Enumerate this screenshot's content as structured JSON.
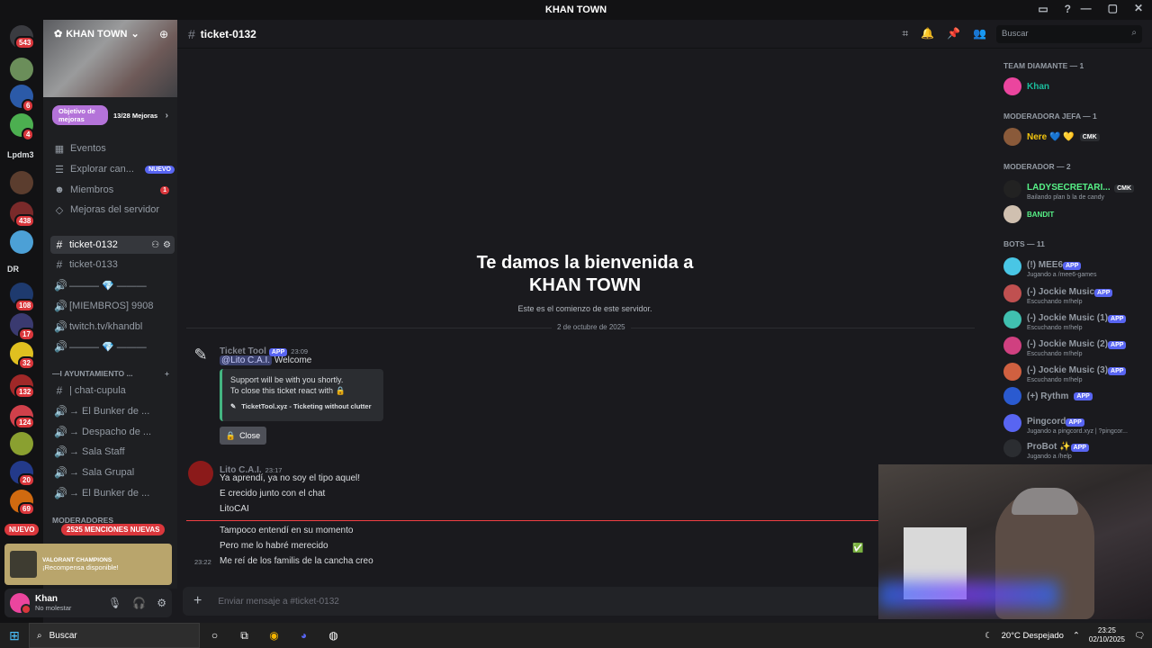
{
  "window": {
    "title": "KHAN TOWN"
  },
  "servers": {
    "top_badge": "543",
    "badges": [
      "6",
      "4",
      "438",
      "108",
      "17",
      "32",
      "132",
      "124",
      "20",
      "69"
    ],
    "lpdm_label": "Lpdm3",
    "dr_label": "DR",
    "nuevo": "NUEVO"
  },
  "sidebar": {
    "server_name": "KHAN TOWN",
    "boost_goal": "Objetivo de mejoras",
    "boost_progress": "13/28 Mejoras",
    "menu": [
      {
        "label": "Eventos"
      },
      {
        "label": "Explorar can...",
        "tag": "NUEVO"
      },
      {
        "label": "Miembros",
        "count": "1"
      },
      {
        "label": "Mejoras del servidor"
      }
    ],
    "channels": [
      {
        "label": "ticket-0132"
      },
      {
        "label": "ticket-0133"
      },
      {
        "label": "——— 💎 ———"
      },
      {
        "label": "[MIEMBROS] 9908"
      },
      {
        "label": "twitch.tv/khandbl"
      },
      {
        "label": "——— 💎 ———"
      }
    ],
    "category1": "—ι AYUNTAMIENTO ...",
    "channels2": [
      {
        "label": "| chat-cupula"
      },
      {
        "label": "→ El Bunker de ..."
      },
      {
        "label": "→ Despacho de ..."
      },
      {
        "label": "→ Sala Staff"
      },
      {
        "label": "→ Sala Grupal"
      },
      {
        "label": "→ El Bunker de ..."
      }
    ],
    "category2": "MODERADORES",
    "mentions": "2525 MENCIONES NUEVAS",
    "reward_title": "VALORANT CHAMPIONS",
    "reward_text": "¡Recompensa disponible!"
  },
  "user": {
    "name": "Khan",
    "status": "No molestar"
  },
  "header": {
    "channel": "ticket-0132",
    "search_placeholder": "Buscar"
  },
  "chat": {
    "welcome_title": "Te damos la bienvenida a KHAN TOWN",
    "welcome_sub": "Este es el comienzo de este servidor.",
    "date_divider": "2 de octubre de 2025",
    "msg1": {
      "author": "Ticket Tool",
      "tag": "APP",
      "time": "23:09",
      "mention": "@Lito C.A.I.",
      "text": "Welcome",
      "embed_line1": "Support will be with you shortly.",
      "embed_line2": "To close this ticket react with 🔒",
      "embed_footer": "TicketTool.xyz - Ticketing without clutter",
      "button": "Close"
    },
    "msg2": {
      "author": "Lito C.A.I.",
      "time": "23:17",
      "lines": [
        "Ya aprendí, ya no soy el tipo aquel!",
        "E crecido junto con el chat",
        "LitoCAI"
      ]
    },
    "msg3": {
      "lines": [
        "Tampoco entendí en su momento",
        "Pero me lo habré merecido",
        "Me reí de los familis de la cancha creo"
      ],
      "time_last": "23:22"
    },
    "composer_placeholder": "Enviar mensaje a #ticket-0132"
  },
  "members": {
    "groups": [
      {
        "title": "TEAM DIAMANTE — 1"
      },
      {
        "title": "MODERADORA JEFA — 1"
      },
      {
        "title": "MODERADOR — 2"
      },
      {
        "title": "BOTS — 11"
      }
    ],
    "list": [
      {
        "name": "Khan",
        "color": "#1abc9c"
      },
      {
        "name": "Nere 💙 💛",
        "color": "#f1c40f",
        "tag": "CMK"
      },
      {
        "name": "LADYSECRETARI...",
        "color": "#57f287",
        "tag": "CMK",
        "status": "Bailando plan b la de candy"
      },
      {
        "name": "BANDIT",
        "color": "#57f287"
      },
      {
        "name": "(!) MEE6",
        "status": "Jugando a /mee6-games"
      },
      {
        "name": "(-) Jockie Music",
        "status": "Escuchando m!help"
      },
      {
        "name": "(-) Jockie Music (1)",
        "status": "Escuchando m!help"
      },
      {
        "name": "(-) Jockie Music (2)",
        "status": "Escuchando m!help"
      },
      {
        "name": "(-) Jockie Music (3)",
        "status": "Escuchando m!help"
      },
      {
        "name": "(+) Rythm"
      },
      {
        "name": "Pingcord",
        "status": "Jugando a pingcord.xyz | ?pingcor..."
      },
      {
        "name": "ProBot ✨",
        "status": "Jugando a /help"
      }
    ],
    "app_tag": "APP"
  },
  "taskbar": {
    "search": "Buscar",
    "weather": "20°C  Despejado",
    "time": "23:25",
    "date": "02/10/2025"
  }
}
